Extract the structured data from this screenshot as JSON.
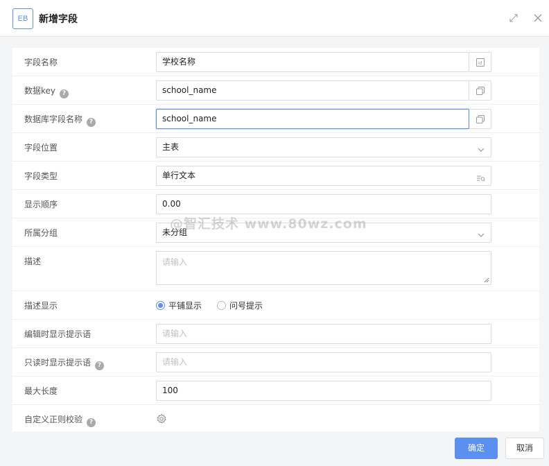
{
  "dialog": {
    "logo_text": "EB",
    "title": "新增字段",
    "ok_label": "确定",
    "cancel_label": "取消"
  },
  "fields": {
    "name": {
      "label": "字段名称",
      "value": "学校名称"
    },
    "data_key": {
      "label": "数据key",
      "value": "school_name"
    },
    "db_field": {
      "label": "数据库字段名称",
      "value": "school_name"
    },
    "position": {
      "label": "字段位置",
      "value": "主表"
    },
    "type": {
      "label": "字段类型",
      "value": "单行文本"
    },
    "order": {
      "label": "显示顺序",
      "value": "0.00"
    },
    "group": {
      "label": "所属分组",
      "value": "未分组"
    },
    "desc": {
      "label": "描述",
      "placeholder": "请输入"
    },
    "desc_display": {
      "label": "描述显示",
      "options": [
        "平铺显示",
        "问号提示"
      ],
      "selected": "平铺显示"
    },
    "edit_hint": {
      "label": "编辑时显示提示语",
      "placeholder": "请输入"
    },
    "readonly_hint": {
      "label": "只读时显示提示语",
      "placeholder": "请输入"
    },
    "max_length": {
      "label": "最大长度",
      "value": "100"
    },
    "custom_regex": {
      "label": "自定义正则校验"
    }
  },
  "watermark": "@智汇技术 www.80wz.com",
  "colors": {
    "primary": "#5b8ff0"
  }
}
